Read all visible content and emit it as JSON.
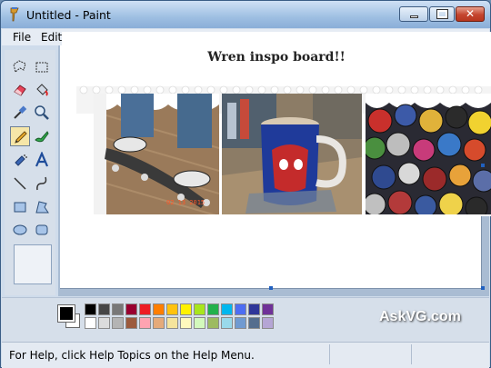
{
  "window": {
    "title": "Untitled - Paint"
  },
  "menu": {
    "items": [
      {
        "label": "File",
        "underline": "F"
      },
      {
        "label": "Edit",
        "underline": "E"
      }
    ]
  },
  "toolbox": {
    "tools": [
      {
        "name": "free-form-select-icon"
      },
      {
        "name": "select-icon"
      },
      {
        "name": "eraser-icon"
      },
      {
        "name": "fill-bucket-icon"
      },
      {
        "name": "color-picker-icon"
      },
      {
        "name": "magnifier-icon"
      },
      {
        "name": "pencil-icon",
        "active": true
      },
      {
        "name": "brush-icon"
      },
      {
        "name": "airbrush-icon"
      },
      {
        "name": "text-icon"
      },
      {
        "name": "line-icon"
      },
      {
        "name": "curve-icon"
      },
      {
        "name": "rectangle-icon"
      },
      {
        "name": "polygon-icon"
      },
      {
        "name": "ellipse-icon"
      },
      {
        "name": "rounded-rectangle-icon"
      }
    ]
  },
  "canvas": {
    "board_title": "Wren inspo board!!",
    "photos": [
      {
        "name": "skateboard-photo",
        "stamp": "02 13 2015"
      },
      {
        "name": "spiderman-mug-photo"
      },
      {
        "name": "bottle-caps-photo"
      }
    ]
  },
  "palette": {
    "foreground": "#000000",
    "background": "#ffffff",
    "row1": [
      "#000000",
      "#464646",
      "#787878",
      "#990030",
      "#ed1c24",
      "#ff7e00",
      "#ffc20e",
      "#fff200",
      "#a8e61d",
      "#22b14c",
      "#00b7ef",
      "#4d6df3",
      "#2f3699",
      "#6f3198"
    ],
    "row2": [
      "#ffffff",
      "#dcdcdc",
      "#b4b4b4",
      "#9c5a3c",
      "#ffa3b1",
      "#e5aa7a",
      "#f5e49c",
      "#fff9bd",
      "#d3f9bc",
      "#9dbb61",
      "#99d9ea",
      "#709ad1",
      "#546d8e",
      "#b5a5d5"
    ]
  },
  "watermark": "AskVG.com",
  "status": {
    "help_text": "For Help, click Help Topics on the Help Menu."
  }
}
